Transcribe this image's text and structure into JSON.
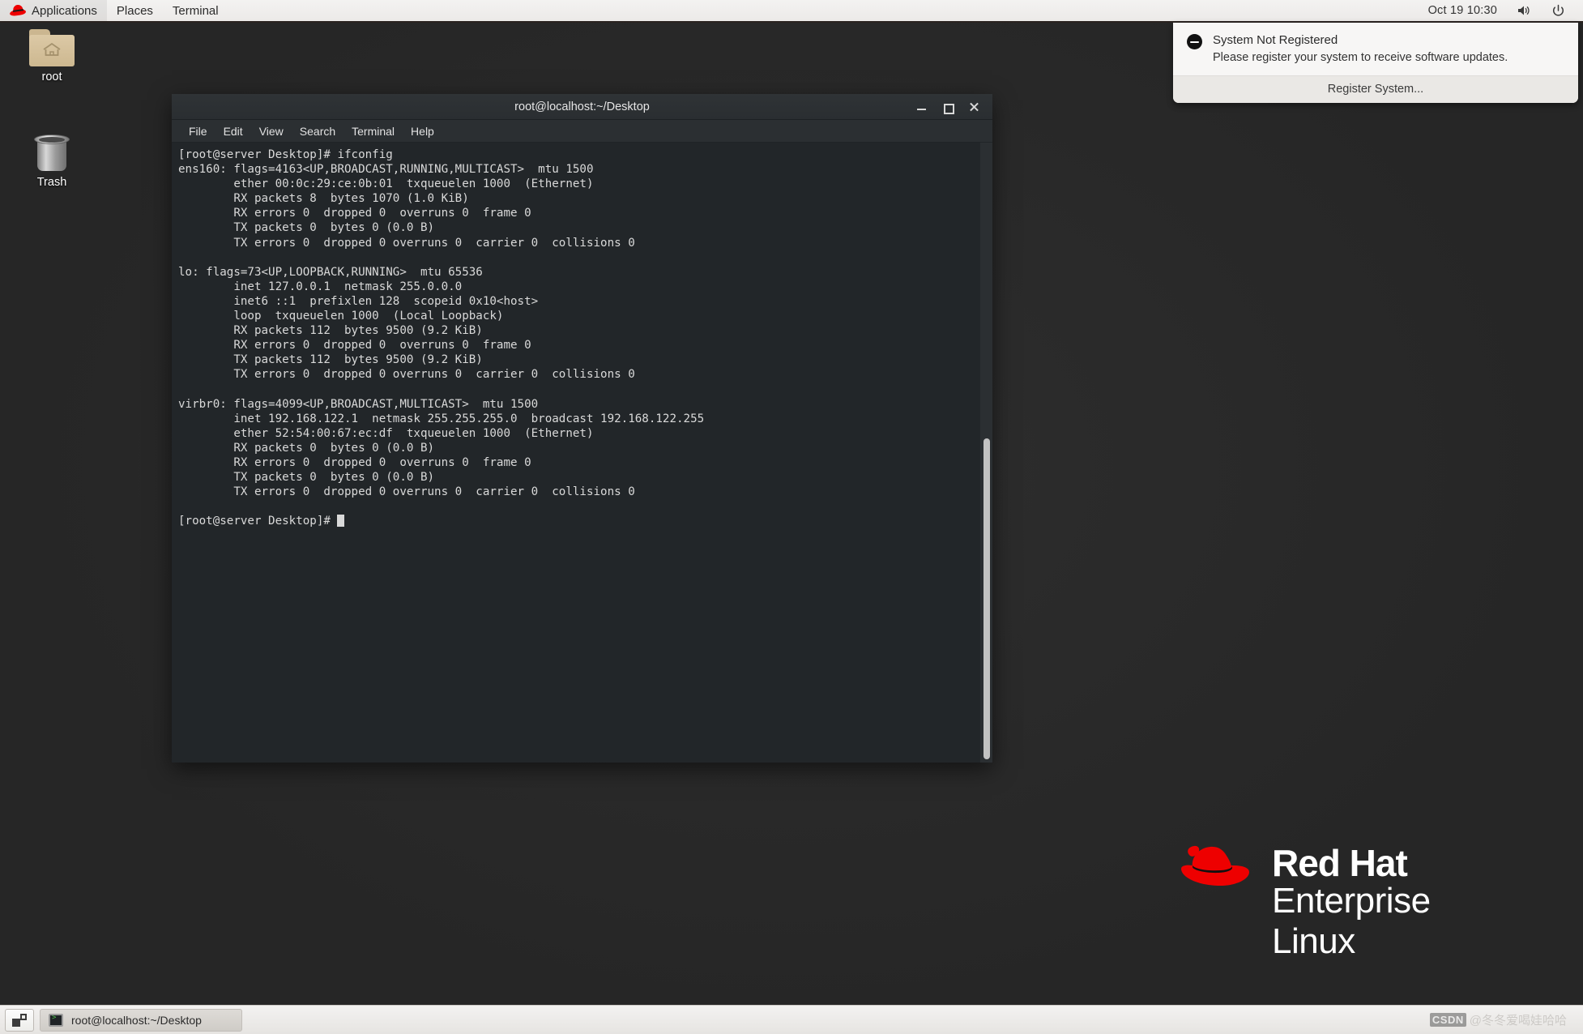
{
  "top_panel": {
    "logo_icon": "redhat-hat-icon",
    "menus": [
      {
        "label": "Applications"
      },
      {
        "label": "Places"
      },
      {
        "label": "Terminal"
      }
    ],
    "clock": "Oct 19  10:30",
    "volume_icon": "volume-icon",
    "power_icon": "power-icon"
  },
  "notification": {
    "icon": "minus-circle-icon",
    "title": "System Not Registered",
    "message": "Please register your system to receive software updates.",
    "action_label": "Register System..."
  },
  "desktop": {
    "background_color": "#262626",
    "icons": [
      {
        "name": "root",
        "label": "root",
        "icon": "home-folder-icon"
      },
      {
        "name": "trash",
        "label": "Trash",
        "icon": "trash-can-icon"
      }
    ]
  },
  "terminal": {
    "title": "root@localhost:~/Desktop",
    "menu": [
      "File",
      "Edit",
      "View",
      "Search",
      "Terminal",
      "Help"
    ],
    "window_buttons": {
      "minimize": "minimize-icon",
      "maximize": "maximize-icon",
      "close": "close-icon"
    },
    "background_color": "#222629",
    "text_color": "#d9d9d9",
    "content": "[root@server Desktop]# ifconfig\nens160: flags=4163<UP,BROADCAST,RUNNING,MULTICAST>  mtu 1500\n        ether 00:0c:29:ce:0b:01  txqueuelen 1000  (Ethernet)\n        RX packets 8  bytes 1070 (1.0 KiB)\n        RX errors 0  dropped 0  overruns 0  frame 0\n        TX packets 0  bytes 0 (0.0 B)\n        TX errors 0  dropped 0 overruns 0  carrier 0  collisions 0\n\nlo: flags=73<UP,LOOPBACK,RUNNING>  mtu 65536\n        inet 127.0.0.1  netmask 255.0.0.0\n        inet6 ::1  prefixlen 128  scopeid 0x10<host>\n        loop  txqueuelen 1000  (Local Loopback)\n        RX packets 112  bytes 9500 (9.2 KiB)\n        RX errors 0  dropped 0  overruns 0  frame 0\n        TX packets 112  bytes 9500 (9.2 KiB)\n        TX errors 0  dropped 0 overruns 0  carrier 0  collisions 0\n\nvirbr0: flags=4099<UP,BROADCAST,MULTICAST>  mtu 1500\n        inet 192.168.122.1  netmask 255.255.255.0  broadcast 192.168.122.255\n        ether 52:54:00:67:ec:df  txqueuelen 1000  (Ethernet)\n        RX packets 0  bytes 0 (0.0 B)\n        RX errors 0  dropped 0  overruns 0  frame 0\n        TX packets 0  bytes 0 (0.0 B)\n        TX errors 0  dropped 0 overruns 0  carrier 0  collisions 0\n\n[root@server Desktop]# ",
    "prompt": "[root@server Desktop]# ",
    "command": "ifconfig"
  },
  "branding": {
    "line1": "Red Hat",
    "line2": "Enterprise Linux",
    "logo_icon": "redhat-fedora-icon",
    "accent_color": "#ee0000"
  },
  "taskbar": {
    "show_desktop_icon": "show-desktop-icon",
    "tasks": [
      {
        "label": "root@localhost:~/Desktop",
        "icon": "terminal-icon"
      }
    ],
    "watermark_badge": "CSDN",
    "watermark_text": "@冬冬爱喝娃哈哈"
  }
}
